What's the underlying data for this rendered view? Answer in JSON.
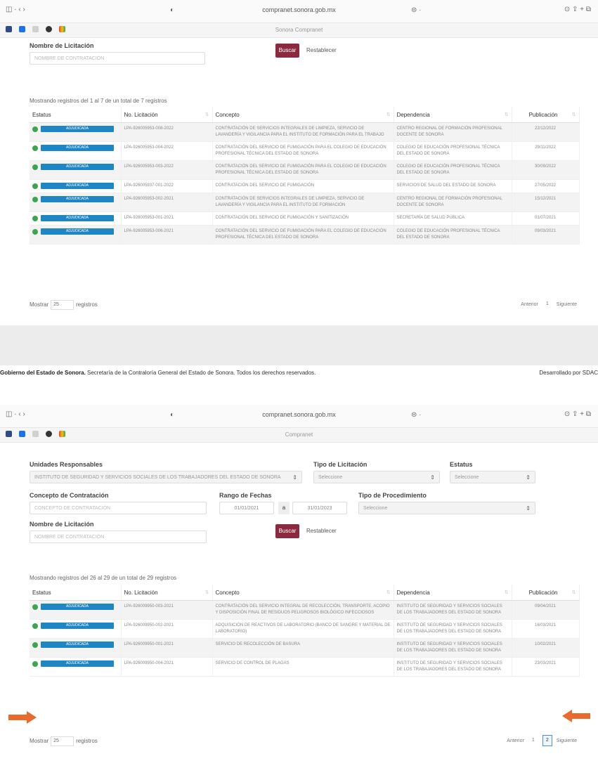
{
  "screen1": {
    "browser": {
      "url": "compranet.sonora.gob.mx",
      "tab_title": "Sonora Compranet",
      "nav": "◫ ·  ‹  ›",
      "half": "◐",
      "wifi": "⊜ ·",
      "right_icons": "⊙  ⇪  +  ⧉"
    },
    "nombre_label": "Nombre de Licitación",
    "nombre_placeholder": "NOMBRE DE CONTRATACIÓN",
    "buscar": "Buscar",
    "restablecer": "Restablecer",
    "info": "Mostrando registros del 1 al 7 de un total de 7 registros",
    "columns": [
      "Estatus",
      "No. Licitación",
      "Concepto",
      "Dependencia",
      "Publicación"
    ],
    "badge": "ADJUDICADA",
    "rows": [
      {
        "num": "LPA-926005953-008-2022",
        "concepto": "CONTRATACIÓN DE SERVICIOS INTEGRALES DE LIMPIEZA, SERVICIO DE LAVANDERÍA Y VIGILANCIA PARA EL INSTITUTO DE FORMACIÓN PARA EL TRABAJO",
        "dep": "CENTRO REGIONAL DE FORMACIÓN PROFESIONAL DOCENTE DE SONORA",
        "pub": "22/12/2022"
      },
      {
        "num": "LPA-926005953-004-2022",
        "concepto": "CONTRATACIÓN DEL SERVICIO DE FUMIGACIÓN PARA EL COLEGIO DE EDUCACIÓN PROFESIONAL TÉCNICA DEL ESTADO DE SONORA",
        "dep": "COLEGIO DE EDUCACIÓN PROFESIONAL TÉCNICA DEL ESTADO DE SONORA",
        "pub": "29/11/2022"
      },
      {
        "num": "LPA-926005953-003-2022",
        "concepto": "CONTRATACIÓN DEL SERVICIO DE FUMIGACIÓN PARA EL COLEGIO DE EDUCACIÓN PROFESIONAL TÉCNICA DEL ESTADO DE SONORA",
        "dep": "COLEGIO DE EDUCACIÓN PROFESIONAL TÉCNICA DEL ESTADO DE SONORA",
        "pub": "30/09/2022"
      },
      {
        "num": "LPA-926005937-001-2022",
        "concepto": "CONTRATACIÓN DEL SERVICIO DE FUMIGACIÓN",
        "dep": "SERVICIOS DE SALUD DEL ESTADO DE SONORA",
        "pub": "27/05/2022"
      },
      {
        "num": "LPA-926005953-002-2021",
        "concepto": "CONTRATACIÓN DE SERVICIOS INTEGRALES DE LIMPIEZA, SERVICIO DE LAVANDERÍA Y VIGILANCIA PARA EL INSTITUTO DE FORMACIÓN",
        "dep": "CENTRO REGIONAL DE FORMACIÓN PROFESIONAL DOCENTE DE SONORA",
        "pub": "15/12/2021"
      },
      {
        "num": "LPA-926005953-001-2021",
        "concepto": "CONTRATACIÓN DEL SERVICIO DE FUMIGACIÓN Y SANITIZACIÓN",
        "dep": "SECRETARÍA DE SALUD PÚBLICA",
        "pub": "01/07/2021"
      },
      {
        "num": "LPA-926005953-006-2021",
        "concepto": "CONTRATACIÓN DEL SERVICIO DE FUMIGACIÓN PARA EL COLEGIO DE EDUCACIÓN PROFESIONAL TÉCNICA DEL ESTADO DE SONORA",
        "dep": "COLEGIO DE EDUCACIÓN PROFESIONAL TÉCNICA DEL ESTADO DE SONORA",
        "pub": "09/03/2021"
      }
    ],
    "mostrar": "Mostrar",
    "mostrar_value": "25",
    "registros": "registros",
    "anterior": "Anterior",
    "page1": "1",
    "siguiente": "Siguiente"
  },
  "footer": {
    "bold": "Gobierno del Estado de Sonora.",
    "text": " Secretaría de la Contraloría General del Estado de Sonora. Todos los derechos reservados.",
    "right": "Desarrollado por SDAC"
  },
  "screen2": {
    "browser": {
      "url": "compranet.sonora.gob.mx",
      "tab_title": "Compranet",
      "nav": "◫ ·  ‹  ›",
      "half": "◐",
      "wifi": "⊜ ·",
      "right_icons": "⊙  ⇪  +  ⧉"
    },
    "unidades_label": "Unidades Responsables",
    "unidades_value": "INSTITUTO DE SEGURIDAD Y SERVICIOS SOCIALES DE LOS TRABAJADORES DEL ESTADO DE SONORA",
    "tipo_label": "Tipo de Licitación",
    "tipo_value": "Seleccione",
    "estatus_label": "Estatus",
    "estatus_value": "Seleccione",
    "concepto_label": "Concepto de Contratación",
    "concepto_placeholder": "CONCEPTO DE CONTRATACIÓN",
    "rango_label": "Rango de Fechas",
    "fecha_ini": "01/01/2021",
    "fecha_a": "a",
    "fecha_fin": "31/01/2023",
    "procedimiento_label": "Tipo de Procedimiento",
    "procedimiento_value": "Seleccione",
    "nombre_label": "Nombre de Licitación",
    "nombre_placeholder": "NOMBRE DE CONTRATACIÓN",
    "buscar": "Buscar",
    "restablecer": "Restablecer",
    "info": "Mostrando registros del 26 al 29 de un total de 29 registros",
    "columns": [
      "Estatus",
      "No. Licitación",
      "Concepto",
      "Dependencia",
      "Publicación"
    ],
    "badge": "ADJUDICADA",
    "rows": [
      {
        "num": "LPA-926009950-003-2021",
        "concepto": "CONTRATACIÓN DEL SERVICIO INTEGRAL DE RECOLECCIÓN, TRANSPORTE, ACOPIO Y DISPOSICIÓN FINAL DE RESIDUOS PELIGROSOS BIOLÓGICO INFECCIOSOS",
        "dep": "INSTITUTO DE SEGURIDAD Y SERVICIOS SOCIALES DE LOS TRABAJADORES DEL ESTADO DE SONORA",
        "pub": "09/04/2021"
      },
      {
        "num": "LPA-926009950-002-2021",
        "concepto": "ADQUISICIÓN DE REACTIVOS DE LABORATORIO (BANCO DE SANGRE Y MATERIAL DE LABORATORIO)",
        "dep": "INSTITUTO DE SEGURIDAD Y SERVICIOS SOCIALES DE LOS TRABAJADORES DEL ESTADO DE SONORA",
        "pub": "16/03/2021"
      },
      {
        "num": "LPA-926009950-001-2021",
        "concepto": "SERVICIO DE RECOLECCIÓN DE BASURA",
        "dep": "INSTITUTO DE SEGURIDAD Y SERVICIOS SOCIALES DE LOS TRABAJADORES DEL ESTADO DE SONORA",
        "pub": "10/02/2021"
      },
      {
        "num": "LPA-926009950-004-2021",
        "concepto": "SERVICIO DE CONTROL DE PLAGAS",
        "dep": "INSTITUTO DE SEGURIDAD Y SERVICIOS SOCIALES DE LOS TRABAJADORES DEL ESTADO DE SONORA",
        "pub": "23/03/2021"
      }
    ],
    "mostrar": "Mostrar",
    "mostrar_value": "25",
    "registros": "registros",
    "anterior": "Anterior",
    "page1": "1",
    "page2": "2",
    "siguiente": "Siguiente"
  },
  "colors": {
    "buscar": "#8b2a3f",
    "badge": "#1f86c6",
    "dot": "#3ca552",
    "arrow": "#e86a2c"
  },
  "icons": [
    "sidebar-icon",
    "back-icon",
    "forward-icon",
    "shield-icon",
    "share-icon",
    "plus-icon",
    "tabs-icon",
    "arrow-right-icon",
    "arrow-left-icon"
  ]
}
